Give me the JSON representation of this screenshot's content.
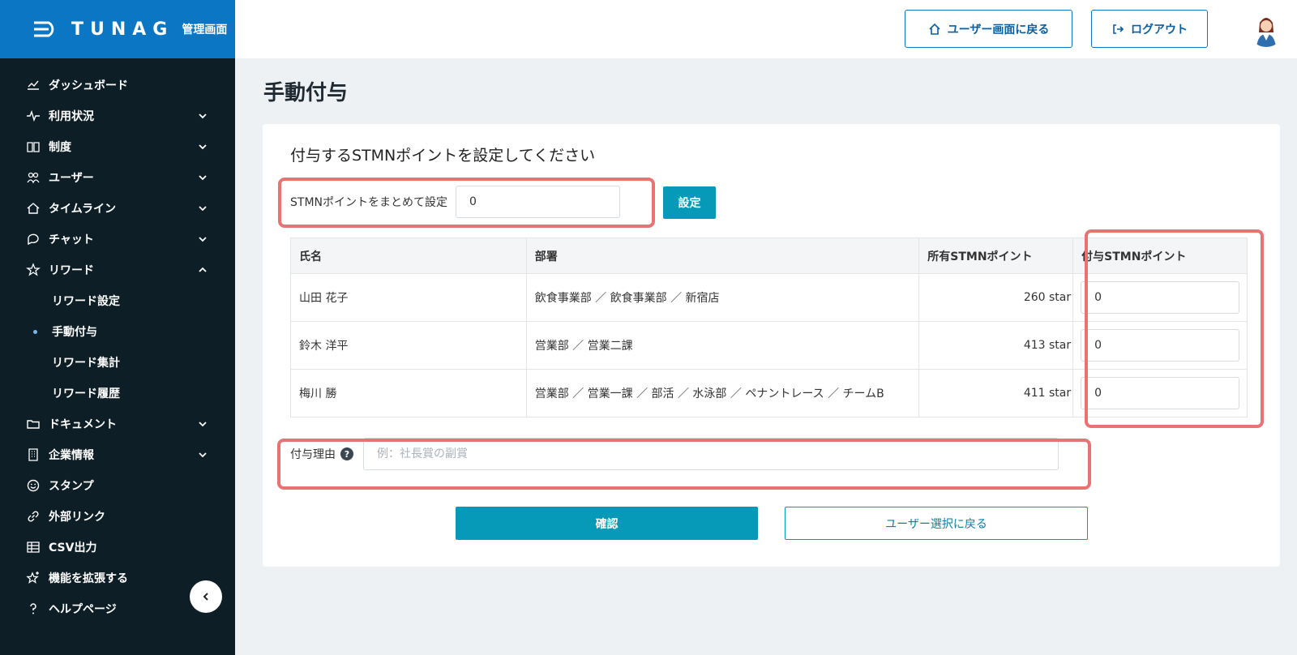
{
  "brand": {
    "wordmark": "TUNAG",
    "subtitle": "管理画面",
    "color": "#0a76c4"
  },
  "sidebar": {
    "items": [
      {
        "label": "ダッシュボード",
        "icon": "chart-line-icon",
        "expandable": false
      },
      {
        "label": "利用状況",
        "icon": "pulse-icon",
        "expandable": true,
        "expanded": false
      },
      {
        "label": "制度",
        "icon": "book-icon",
        "expandable": true,
        "expanded": false
      },
      {
        "label": "ユーザー",
        "icon": "users-icon",
        "expandable": true,
        "expanded": false
      },
      {
        "label": "タイムライン",
        "icon": "home-icon",
        "expandable": true,
        "expanded": false
      },
      {
        "label": "チャット",
        "icon": "chat-bubble-icon",
        "expandable": true,
        "expanded": false
      },
      {
        "label": "リワード",
        "icon": "star-icon",
        "expandable": true,
        "expanded": true
      },
      {
        "label": "ドキュメント",
        "icon": "folder-icon",
        "expandable": true,
        "expanded": false
      },
      {
        "label": "企業情報",
        "icon": "building-icon",
        "expandable": true,
        "expanded": false
      },
      {
        "label": "スタンプ",
        "icon": "smiley-icon",
        "expandable": false
      },
      {
        "label": "外部リンク",
        "icon": "link-icon",
        "expandable": false
      },
      {
        "label": "CSV出力",
        "icon": "table-icon",
        "expandable": false
      },
      {
        "label": "機能を拡張する",
        "icon": "star-plus-icon",
        "expandable": false
      },
      {
        "label": "ヘルプページ",
        "icon": "question-icon",
        "expandable": false
      }
    ],
    "reward_sub": [
      {
        "label": "リワード設定",
        "active": false
      },
      {
        "label": "手動付与",
        "active": true
      },
      {
        "label": "リワード集計",
        "active": false
      },
      {
        "label": "リワード履歴",
        "active": false
      }
    ]
  },
  "header": {
    "user_screen_label": "ユーザー画面に戻る",
    "logout_label": "ログアウト"
  },
  "page": {
    "title": "手動付与",
    "heading": "付与するSTMNポイントを設定してください",
    "bulk_label": "STMNポイントをまとめて設定",
    "bulk_value": "0",
    "set_label": "設定",
    "table": {
      "headers": [
        "氏名",
        "部署",
        "所有STMNポイント",
        "付与STMNポイント"
      ],
      "rows": [
        {
          "name": "山田 花子",
          "dept": "飲食事業部 ／ 飲食事業部 ／ 新宿店",
          "owned": "260 star",
          "grant": "0"
        },
        {
          "name": "鈴木 洋平",
          "dept": "営業部 ／ 営業二課",
          "owned": "413 star",
          "grant": "0"
        },
        {
          "name": "梅川 勝",
          "dept": "営業部 ／ 営業一課 ／ 部活 ／ 水泳部 ／ ペナントレース ／ チームB",
          "owned": "411 star",
          "grant": "0"
        }
      ]
    },
    "reason_label": "付与理由",
    "reason_placeholder": "例：社長賞の副賞",
    "confirm_label": "確認",
    "back_label": "ユーザー選択に戻る"
  },
  "colors": {
    "accent": "#0799b8",
    "sidebar_bg": "#0e1e26",
    "highlight": "#e97273"
  }
}
